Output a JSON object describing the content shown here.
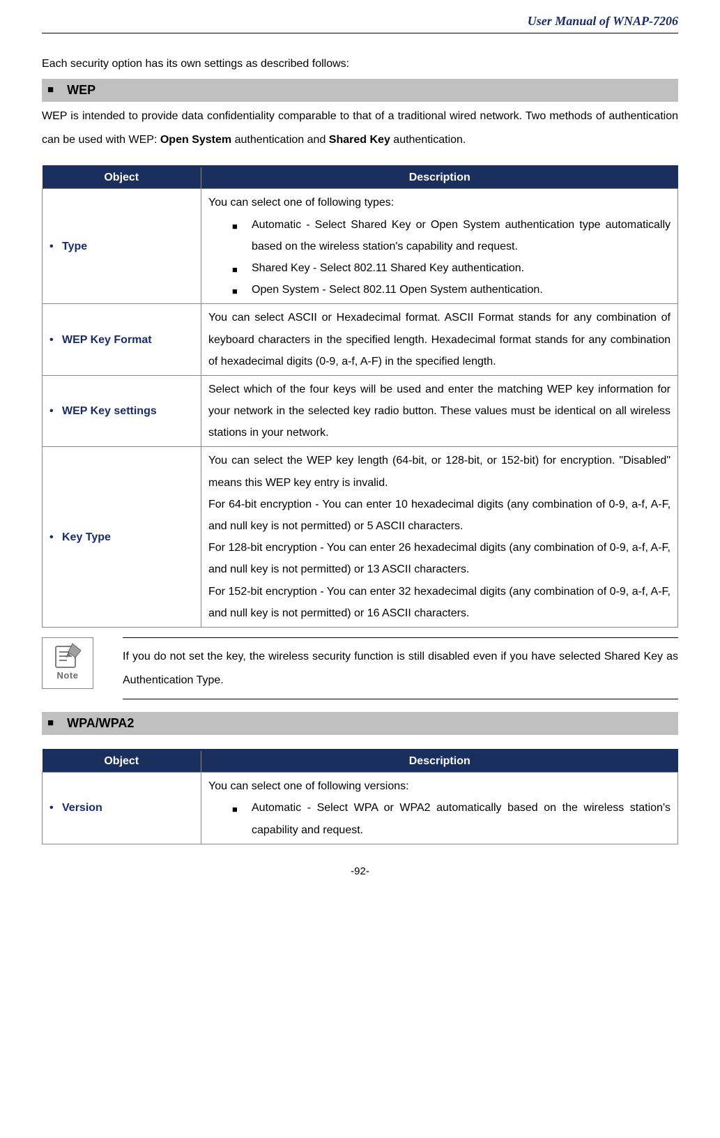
{
  "header": {
    "title": "User Manual of WNAP-7206"
  },
  "intro": "Each security option has its own settings as described follows:",
  "section_wep": {
    "title": "WEP",
    "para_parts": {
      "p1": "WEP is intended to provide data confidentiality comparable to that of a traditional wired network. Two methods of authentication can be used with WEP: ",
      "b1": "Open System",
      "mid": " authentication and ",
      "b2": "Shared Key",
      "p2": " authentication."
    }
  },
  "table1": {
    "head_obj": "Object",
    "head_desc": "Description",
    "rows": [
      {
        "obj": "Type",
        "desc_lead": "You can select one of following types:",
        "items": [
          {
            "lead_bold": "Automatic -",
            "rest": " Select ",
            "bold2": "Shared Key",
            "mid": " or ",
            "bold3": "Open System",
            "rest2": " authentication type automatically based on the wireless station's capability and request."
          },
          {
            "lead_bold": "Shared Key -",
            "rest": "   Select 802.11 Shared Key authentication."
          },
          {
            "lead_bold": "Open System -",
            "rest": " Select 802.11 Open System authentication."
          }
        ]
      },
      {
        "obj": "WEP Key Format",
        "desc_plain_parts": {
          "a": "You can select ",
          "b1": "ASCII",
          "b": " or ",
          "b2": "Hexadecimal",
          "c": " format. ASCII Format stands for any combination of keyboard characters in the specified length. Hexadecimal format stands for any combination of hexadecimal digits (0-9, a-f, A-F) in the specified length."
        }
      },
      {
        "obj": "WEP Key settings",
        "desc_plain": "Select which of the four keys will be used and enter the matching WEP key information for your network in the selected key radio button. These values must be identical on all wireless stations in your network."
      },
      {
        "obj": "Key Type",
        "keytype": {
          "intro": "You can select the WEP key length (64-bit, or 128-bit, or 152-bit) for encryption. \"Disabled\" means this WEP key entry is invalid.",
          "p64_b": "For 64-bit encryption",
          "p64": " - You can enter 10 hexadecimal digits (any combination of 0-9, a-f, A-F, and null key is not permitted) or 5 ASCII characters.",
          "p128_b": "For 128-bit encryption",
          "p128": " - You can enter 26 hexadecimal digits (any combination of 0-9, a-f, A-F, and null key is not permitted) or 13 ASCII characters.",
          "p152_b": "For 152-bit encryption",
          "p152": " - You can enter 32 hexadecimal digits (any combination of 0-9, a-f, A-F, and null key is not permitted) or 16 ASCII characters."
        }
      }
    ]
  },
  "note": {
    "label": "Note",
    "text": "If you do not set the key, the wireless security function is still disabled even if you have selected Shared Key as Authentication Type."
  },
  "section_wpa": {
    "title": "WPA/WPA2"
  },
  "table2": {
    "head_obj": "Object",
    "head_desc": "Description",
    "rows": [
      {
        "obj": "Version",
        "desc_lead": "You can select one of following versions:",
        "items": [
          {
            "lead_bold": "Automatic",
            "rest": " - Select WPA or WPA2 automatically based on the wireless station's capability and request."
          }
        ]
      }
    ]
  },
  "footer": "-92-"
}
